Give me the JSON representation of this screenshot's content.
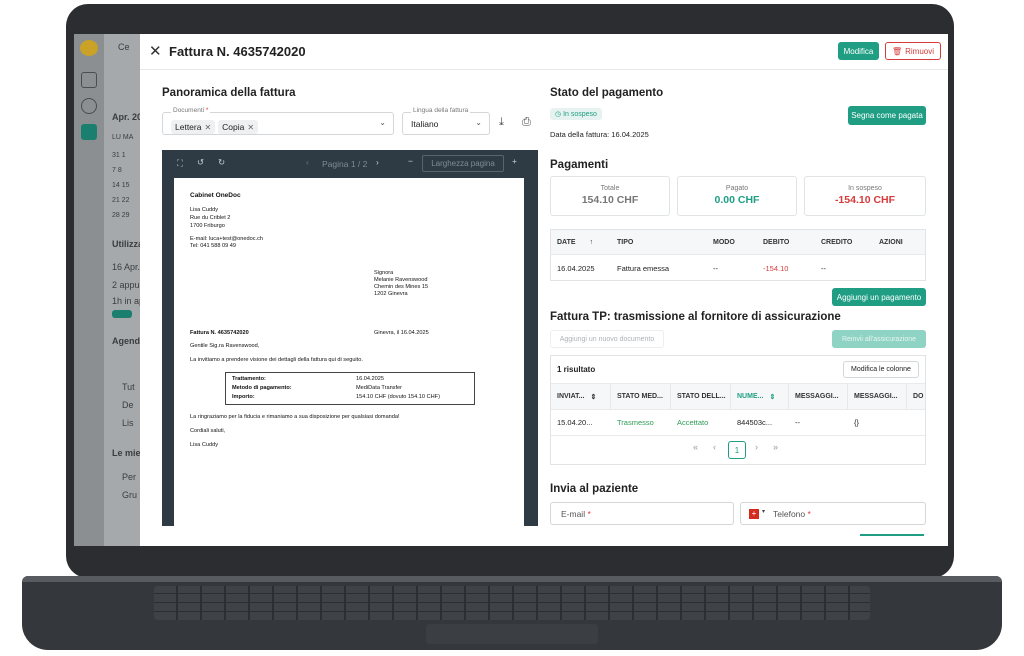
{
  "modal": {
    "title": "Fattura N. 4635742020",
    "edit_label": "Modifica",
    "remove_label": "Rimuovi"
  },
  "overview": {
    "heading": "Panoramica della fattura",
    "documents_label": "Documenti",
    "documents_required": "*",
    "chips": [
      "Lettera",
      "Copia"
    ],
    "language_label": "Lingua della fattura",
    "language_value": "Italiano"
  },
  "viewer": {
    "page_indicator": "Pagina 1 / 2",
    "zoom_label": "Larghezza pagina"
  },
  "letter": {
    "sender": "Cabinet OneDoc",
    "sender_name": "Lisa Cuddy",
    "sender_street": "Rue du Criblet 2",
    "sender_city": "1700 Friburgo",
    "sender_email": "E-mail: luca+test@onedoc.ch",
    "sender_phone": "Tel: 041 588 09 49",
    "recipient_title": "Signora",
    "recipient_name": "Melanie Ravenswood",
    "recipient_street": "Chemin des Mines 15",
    "recipient_city": "1202 Ginevra",
    "invoice_ref": "Fattura N. 4635742020",
    "place_date": "Ginevra, il 16.04.2025",
    "greeting": "Gentile Sig.ra Ravenswood,",
    "intro": "La invitiamo a prendere visione dei dettagli della fattura qui di seguito.",
    "details": [
      {
        "label": "Trattamento:",
        "value": "16.04.2025"
      },
      {
        "label": "Metodo di pagamento:",
        "value": "MediData Transfer"
      },
      {
        "label": "Importo:",
        "value": "154.10 CHF (dovuto 154.10 CHF)"
      }
    ],
    "thanks": "La ringraziamo per la fiducia e rimaniamo a sua disposizione per qualsiasi domanda!",
    "closing": "Cordiali saluti,",
    "signature": "Lisa Cuddy"
  },
  "payment_status": {
    "heading": "Stato del pagamento",
    "badge": "In sospeso",
    "invoice_date": "Data della fattura: 16.04.2025",
    "mark_paid": "Segna come pagata"
  },
  "payments": {
    "heading": "Pagamenti",
    "total_label": "Totale",
    "total_value": "154.10 CHF",
    "paid_label": "Pagato",
    "paid_value": "0.00 CHF",
    "pending_label": "In sospeso",
    "pending_value": "-154.10 CHF",
    "columns": [
      "DATE",
      "TIPO",
      "MODO",
      "DEBITO",
      "CREDITO",
      "AZIONI"
    ],
    "row": {
      "date": "16.04.2025",
      "type": "Fattura emessa",
      "mode": "--",
      "debit": "-154.10",
      "credit": "--",
      "actions": ""
    },
    "add_payment": "Aggiungi un pagamento"
  },
  "tp": {
    "heading": "Fattura TP: trasmissione al fornitore di assicurazione",
    "add_doc": "Aggiungi un nuovo documento",
    "resend": "Reinvii all'assicurazione",
    "results": "1 risultato",
    "edit_columns": "Modifica le colonne",
    "columns": [
      "INVIAT...",
      "STATO MED...",
      "STATO DELL...",
      "NUME...",
      "MESSAGGI...",
      "MESSAGGI...",
      "DO"
    ],
    "row": [
      "15.04.20...",
      "Trasmesso",
      "Accettato",
      "844503c...",
      "--",
      "{}"
    ],
    "page": "1"
  },
  "send": {
    "heading": "Invia al paziente",
    "email_placeholder": "E-mail",
    "phone_placeholder": "Telefono",
    "required": "*"
  },
  "background": {
    "search": "Ce",
    "month": "Apr. 20",
    "weekdays": "LU MA",
    "weeks": [
      "31 1",
      "7 8",
      "14 15",
      "21 22",
      "28 29"
    ],
    "util": "Utilizza",
    "date": "16 Apr.",
    "appts": "2 appun",
    "hours": "1h in ap",
    "agenda": "Agend",
    "all": "Tut",
    "de": "De",
    "lis": "Lis",
    "mine": "Le mie",
    "per": "Per",
    "gru": "Gru"
  },
  "colors": {
    "accent": "#1f9e83",
    "danger": "#d63b3b",
    "viewer_bg": "#2e3b44"
  }
}
